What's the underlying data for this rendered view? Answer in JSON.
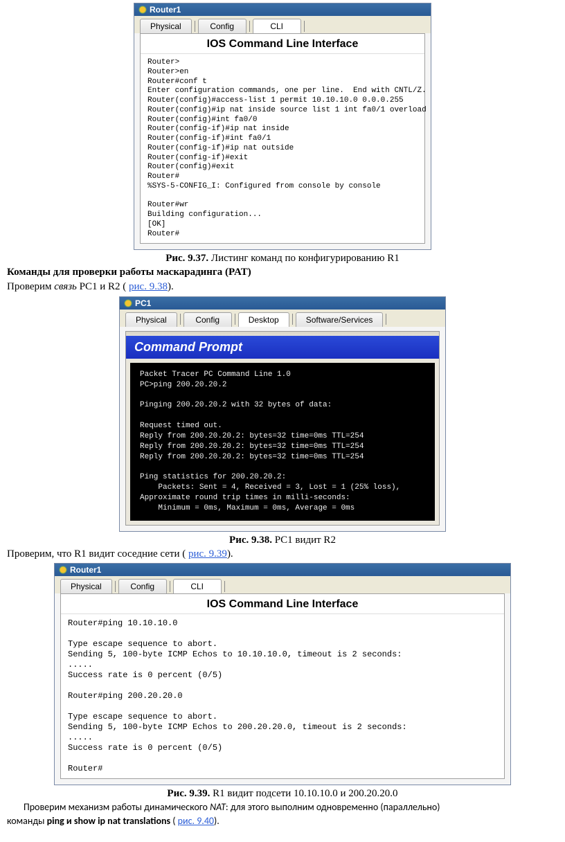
{
  "fig937": {
    "win_title": "Router1",
    "tabs": [
      "Physical",
      "Config",
      "CLI"
    ],
    "active_tab": "CLI",
    "pane_title": "IOS Command Line Interface",
    "cli": "Router>\nRouter>en\nRouter#conf t\nEnter configuration commands, one per line.  End with CNTL/Z.\nRouter(config)#access-list 1 permit 10.10.10.0 0.0.0.255\nRouter(config)#ip nat inside source list 1 int fa0/1 overload\nRouter(config)#int fa0/0\nRouter(config-if)#ip nat inside\nRouter(config-if)#int fa0/1\nRouter(config-if)#ip nat outside\nRouter(config-if)#exit\nRouter(config)#exit\nRouter#\n%SYS-5-CONFIG_I: Configured from console by console\n\nRouter#wr\nBuilding configuration...\n[OK]\nRouter#",
    "caption_fig": "Рис. 9.37.",
    "caption_text": "Листинг команд по конфигурированию R1"
  },
  "text1": {
    "heading": "Команды для проверки работы маскарадинга (PAT)",
    "line_a": "Проверим ",
    "line_a_em": "связь",
    "line_a2": " PC1 и R2 ( ",
    "link": "рис. 9.38",
    "line_a3": ")."
  },
  "fig938": {
    "win_title": "PC1",
    "tabs": [
      "Physical",
      "Config",
      "Desktop",
      "Software/Services"
    ],
    "active_tab": "Desktop",
    "cmd_header": "Command Prompt",
    "cmd_body": "Packet Tracer PC Command Line 1.0\nPC>ping 200.20.20.2\n\nPinging 200.20.20.2 with 32 bytes of data:\n\nRequest timed out.\nReply from 200.20.20.2: bytes=32 time=0ms TTL=254\nReply from 200.20.20.2: bytes=32 time=0ms TTL=254\nReply from 200.20.20.2: bytes=32 time=0ms TTL=254\n\nPing statistics for 200.20.20.2:\n    Packets: Sent = 4, Received = 3, Lost = 1 (25% loss),\nApproximate round trip times in milli-seconds:\n    Minimum = 0ms, Maximum = 0ms, Average = 0ms",
    "caption_fig": "Рис. 9.38.",
    "caption_text": "PC1 видит R2"
  },
  "text2": {
    "line_a": "Проверим, что R1 видит соседние сети ( ",
    "link": "рис. 9.39",
    "line_a2": ")."
  },
  "fig939": {
    "win_title": "Router1",
    "tabs": [
      "Physical",
      "Config",
      "CLI"
    ],
    "active_tab": "CLI",
    "pane_title": "IOS Command Line Interface",
    "cli": "Router#ping 10.10.10.0\n\nType escape sequence to abort.\nSending 5, 100-byte ICMP Echos to 10.10.10.0, timeout is 2 seconds:\n.....\nSuccess rate is 0 percent (0/5)\n\nRouter#ping 200.20.20.0\n\nType escape sequence to abort.\nSending 5, 100-byte ICMP Echos to 200.20.20.0, timeout is 2 seconds:\n.....\nSuccess rate is 0 percent (0/5)\n\nRouter#",
    "caption_fig": "Рис. 9.39.",
    "caption_text": "R1 видит подсети 10.10.10.0 и 200.20.20.0"
  },
  "text3": {
    "p1": "Проверим  механизм  работы  динамического ",
    "p1_em": "NAT",
    "p1b": ":  для  этого  выполним  одновременно  (параллельно)",
    "p2a": "команды ",
    "cmd1": "ping",
    "and": " и ",
    "cmd2": "show ip nat translations",
    "p2b": " ( ",
    "link": "рис. 9.40",
    "p2c": ")."
  }
}
